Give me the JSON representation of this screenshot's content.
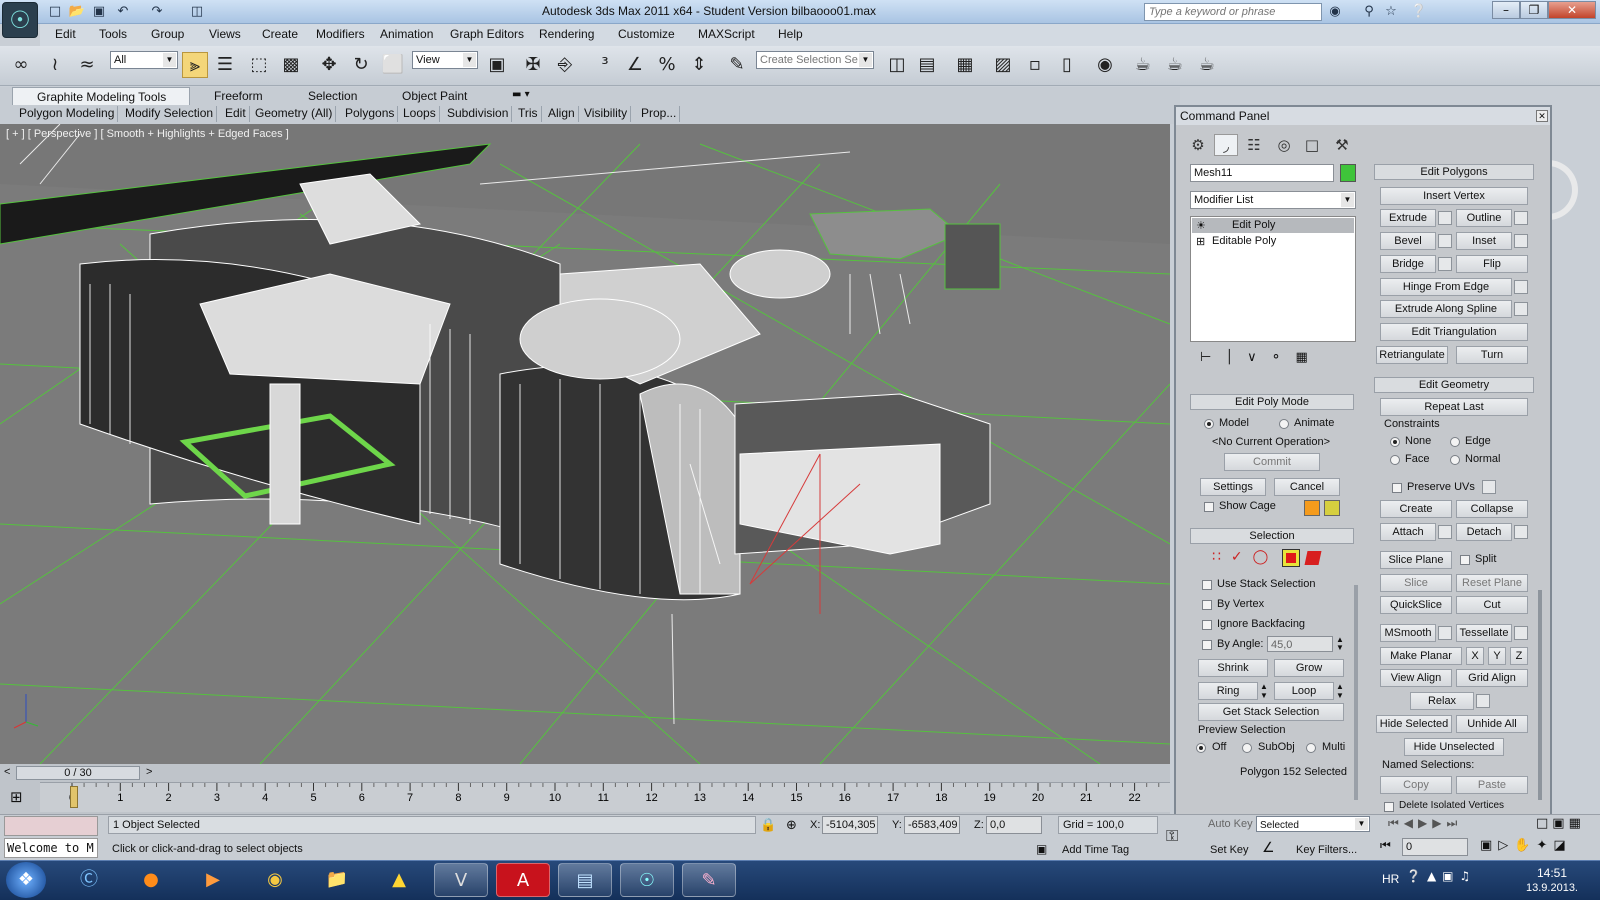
{
  "window": {
    "title": "Autodesk 3ds Max  2011 x64  -  Student Version    bilbaooo01.max",
    "search_placeholder": "Type a keyword or phrase"
  },
  "menu": [
    "Edit",
    "Tools",
    "Group",
    "Views",
    "Create",
    "Modifiers",
    "Animation",
    "Graph Editors",
    "Rendering",
    "Customize",
    "MAXScript",
    "Help"
  ],
  "toolbar": {
    "filter_value": "All",
    "ref_coord_value": "View",
    "selection_set_placeholder": "Create Selection Se"
  },
  "ribbon": {
    "tabs": [
      "Graphite Modeling Tools",
      "Freeform",
      "Selection",
      "Object Paint"
    ],
    "subtabs": [
      "Polygon Modeling",
      "Modify Selection",
      "Edit",
      "Geometry (All)",
      "Polygons",
      "Loops",
      "Subdivision",
      "Tris",
      "Align",
      "Visibility",
      "Prop..."
    ]
  },
  "viewport": {
    "label": "[ + ] [ Perspective ] [ Smooth + Highlights + Edged Faces ]"
  },
  "command_panel": {
    "title": "Command Panel",
    "object_name": "Mesh11",
    "modifier_list": "Modifier List",
    "stack": [
      "Edit Poly",
      "Editable Poly"
    ],
    "edit_poly_mode": {
      "header": "Edit Poly Mode",
      "model": "Model",
      "animate": "Animate",
      "no_op": "<No Current Operation>",
      "commit": "Commit",
      "settings": "Settings",
      "cancel": "Cancel",
      "show_cage": "Show Cage"
    },
    "selection": {
      "header": "Selection",
      "use_stack": "Use Stack Selection",
      "by_vertex": "By Vertex",
      "ignore_backfacing": "Ignore Backfacing",
      "by_angle": "By Angle:",
      "angle_value": "45,0",
      "shrink": "Shrink",
      "grow": "Grow",
      "ring": "Ring",
      "loop": "Loop",
      "get_stack": "Get Stack Selection",
      "preview": "Preview Selection",
      "off": "Off",
      "subobj": "SubObj",
      "multi": "Multi",
      "status": "Polygon 152 Selected"
    },
    "edit_polygons": {
      "header": "Edit Polygons",
      "insert_vertex": "Insert Vertex",
      "extrude": "Extrude",
      "outline": "Outline",
      "bevel": "Bevel",
      "inset": "Inset",
      "bridge": "Bridge",
      "flip": "Flip",
      "hinge": "Hinge From Edge",
      "extrude_spline": "Extrude Along Spline",
      "edit_tri": "Edit Triangulation",
      "retriangulate": "Retriangulate",
      "turn": "Turn"
    },
    "edit_geometry": {
      "header": "Edit Geometry",
      "repeat_last": "Repeat Last",
      "constraints": "Constraints",
      "none": "None",
      "edge": "Edge",
      "face": "Face",
      "normal": "Normal",
      "preserve_uvs": "Preserve UVs",
      "create": "Create",
      "collapse": "Collapse",
      "attach": "Attach",
      "detach": "Detach",
      "slice_plane": "Slice Plane",
      "split": "Split",
      "slice": "Slice",
      "reset_plane": "Reset Plane",
      "quickslice": "QuickSlice",
      "cut": "Cut",
      "msmooth": "MSmooth",
      "tessellate": "Tessellate",
      "make_planar": "Make Planar",
      "x": "X",
      "y": "Y",
      "z": "Z",
      "view_align": "View Align",
      "grid_align": "Grid Align",
      "relax": "Relax",
      "hide_selected": "Hide Selected",
      "unhide_all": "Unhide All",
      "hide_unselected": "Hide Unselected",
      "named_selections": "Named Selections:",
      "copy": "Copy",
      "paste": "Paste",
      "delete_isolated": "Delete Isolated Vertices"
    }
  },
  "timeline": {
    "frame": "0 / 30",
    "ticks": [
      "0",
      "1",
      "2",
      "3",
      "4",
      "5",
      "6",
      "7",
      "8",
      "9",
      "10",
      "11",
      "12",
      "13",
      "14",
      "15",
      "16",
      "17",
      "18",
      "19",
      "20",
      "21",
      "22"
    ],
    "prev": "<",
    "next": ">"
  },
  "status": {
    "maxscript_text": "Welcome to M",
    "selected": "1 Object Selected",
    "prompt": "Click or click-and-drag to select objects",
    "x_label": "X:",
    "x_value": "-5104,305",
    "y_label": "Y:",
    "y_value": "-6583,409",
    "z_label": "Z:",
    "z_value": "0,0",
    "grid": "Grid = 100,0",
    "add_time_tag": "Add Time Tag",
    "auto_key": "Auto Key",
    "selected_dd": "Selected",
    "set_key": "Set Key",
    "key_filters": "Key Filters...",
    "frame_field": "0"
  },
  "taskbar": {
    "lang": "HR",
    "time": "14:51",
    "date": "13.9.2013."
  }
}
